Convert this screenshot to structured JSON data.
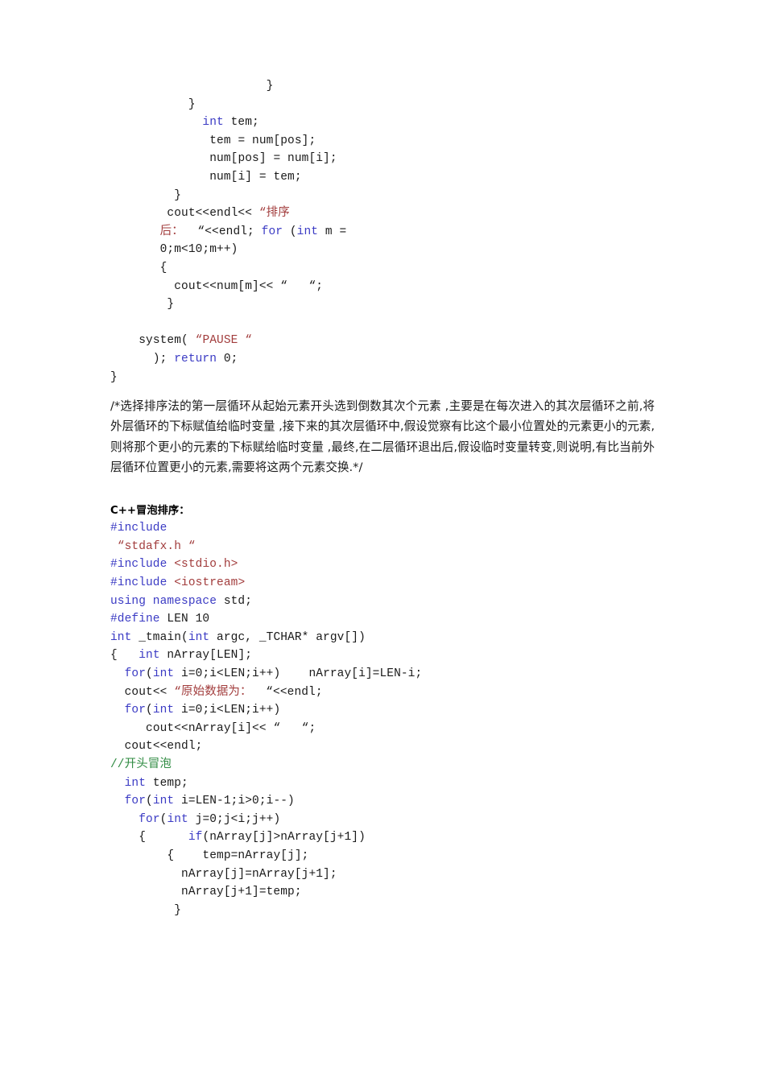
{
  "document": {
    "colors": {
      "keyword": "#3b3bc4",
      "string": "#a23d3d",
      "comment": "#2f8b42",
      "text": "#1a1a1a",
      "background": "#ffffff"
    }
  },
  "selection_sort_tail": {
    "lines": [
      {
        "indent": 22,
        "parts": [
          {
            "t": "}",
            "c": "plain"
          }
        ]
      },
      {
        "indent": 11,
        "parts": [
          {
            "t": "}",
            "c": "plain"
          }
        ]
      },
      {
        "indent": 13,
        "parts": [
          {
            "t": "int",
            "c": "kw"
          },
          {
            "t": " tem;",
            "c": "plain"
          }
        ]
      },
      {
        "indent": 14,
        "parts": [
          {
            "t": "tem = num[pos];",
            "c": "plain"
          }
        ]
      },
      {
        "indent": 14,
        "parts": [
          {
            "t": "num[pos] = num[i];",
            "c": "plain"
          }
        ]
      },
      {
        "indent": 14,
        "parts": [
          {
            "t": "num[i] = tem;",
            "c": "plain"
          }
        ]
      },
      {
        "indent": 9,
        "parts": [
          {
            "t": "}",
            "c": "plain"
          }
        ]
      },
      {
        "indent": 8,
        "parts": [
          {
            "t": "cout<<endl<<",
            "c": "plain"
          },
          {
            "t": " “排序",
            "c": "str"
          }
        ]
      },
      {
        "indent": 7,
        "parts": [
          {
            "t": "后：",
            "c": "str"
          },
          {
            "t": "  “<<endl; ",
            "c": "plain"
          },
          {
            "t": "for",
            "c": "kw"
          },
          {
            "t": " (",
            "c": "plain"
          },
          {
            "t": "int",
            "c": "kw"
          },
          {
            "t": " m =",
            "c": "plain"
          }
        ]
      },
      {
        "indent": 7,
        "parts": [
          {
            "t": "0;m<10;m++)",
            "c": "plain"
          }
        ]
      },
      {
        "indent": 7,
        "parts": [
          {
            "t": "{",
            "c": "plain"
          }
        ]
      },
      {
        "indent": 9,
        "parts": [
          {
            "t": "cout<<num[m]<< “   “;",
            "c": "plain"
          }
        ]
      },
      {
        "indent": 8,
        "parts": [
          {
            "t": "}",
            "c": "plain"
          }
        ]
      },
      {
        "indent": 0,
        "parts": [
          {
            "t": "",
            "c": "plain"
          }
        ]
      },
      {
        "indent": 4,
        "parts": [
          {
            "t": "system( ",
            "c": "plain"
          },
          {
            "t": "“PAUSE “",
            "c": "str"
          }
        ]
      },
      {
        "indent": 6,
        "parts": [
          {
            "t": "); ",
            "c": "plain"
          },
          {
            "t": "return",
            "c": "kw"
          },
          {
            "t": " 0;",
            "c": "plain"
          }
        ]
      },
      {
        "indent": 0,
        "parts": [
          {
            "t": "}",
            "c": "plain"
          }
        ]
      }
    ]
  },
  "explanation": {
    "text": "/*选择排序法的第一层循环从起始元素开头选到倒数其次个元素 ,主要是在每次进入的其次层循环之前,将外层循环的下标赋值给临时变量 ,接下来的其次层循环中,假设觉察有比这个最小位置处的元素更小的元素,则将那个更小的元素的下标赋给临时变量 ,最终,在二层循环退出后,假设临时变量转变,则说明,有比当前外层循环位置更小的元素,需要将这两个元素交换.*/"
  },
  "bubble_sort": {
    "heading": "C++冒泡排序：",
    "lines": [
      {
        "indent": 0,
        "parts": [
          {
            "t": "#include",
            "c": "kw"
          }
        ]
      },
      {
        "indent": 1,
        "parts": [
          {
            "t": "“stdafx.h “",
            "c": "str"
          }
        ]
      },
      {
        "indent": 0,
        "parts": [
          {
            "t": "#include",
            "c": "kw"
          },
          {
            "t": " ",
            "c": "plain"
          },
          {
            "t": "<stdio.h>",
            "c": "str"
          }
        ]
      },
      {
        "indent": 0,
        "parts": [
          {
            "t": "#include",
            "c": "kw"
          },
          {
            "t": " ",
            "c": "plain"
          },
          {
            "t": "<iostream>",
            "c": "str"
          }
        ]
      },
      {
        "indent": 0,
        "parts": [
          {
            "t": "using namespace",
            "c": "kw"
          },
          {
            "t": " std;",
            "c": "plain"
          }
        ]
      },
      {
        "indent": 0,
        "parts": [
          {
            "t": "#define",
            "c": "kw"
          },
          {
            "t": " LEN 10",
            "c": "plain"
          }
        ]
      },
      {
        "indent": 0,
        "parts": [
          {
            "t": "int",
            "c": "kw"
          },
          {
            "t": " _tmain(",
            "c": "plain"
          },
          {
            "t": "int",
            "c": "kw"
          },
          {
            "t": " argc, _TCHAR* argv[])",
            "c": "plain"
          }
        ]
      },
      {
        "indent": 0,
        "parts": [
          {
            "t": "{   ",
            "c": "plain"
          },
          {
            "t": "int",
            "c": "kw"
          },
          {
            "t": " nArray[LEN];",
            "c": "plain"
          }
        ]
      },
      {
        "indent": 2,
        "parts": [
          {
            "t": "for",
            "c": "kw"
          },
          {
            "t": "(",
            "c": "plain"
          },
          {
            "t": "int",
            "c": "kw"
          },
          {
            "t": " i=0;i<LEN;i++)    nArray[i]=LEN-i;",
            "c": "plain"
          }
        ]
      },
      {
        "indent": 2,
        "parts": [
          {
            "t": "cout<< ",
            "c": "plain"
          },
          {
            "t": "“原始数据为：",
            "c": "str"
          },
          {
            "t": "  “<<endl;",
            "c": "plain"
          }
        ]
      },
      {
        "indent": 2,
        "parts": [
          {
            "t": "for",
            "c": "kw"
          },
          {
            "t": "(",
            "c": "plain"
          },
          {
            "t": "int",
            "c": "kw"
          },
          {
            "t": " i=0;i<LEN;i++)",
            "c": "plain"
          }
        ]
      },
      {
        "indent": 5,
        "parts": [
          {
            "t": "cout<<nArray[i]<< “   “;",
            "c": "plain"
          }
        ]
      },
      {
        "indent": 2,
        "parts": [
          {
            "t": "cout<<endl;",
            "c": "plain"
          }
        ]
      },
      {
        "indent": 0,
        "parts": [
          {
            "t": "//开头冒泡",
            "c": "cmt"
          }
        ]
      },
      {
        "indent": 2,
        "parts": [
          {
            "t": "int",
            "c": "kw"
          },
          {
            "t": " temp;",
            "c": "plain"
          }
        ]
      },
      {
        "indent": 2,
        "parts": [
          {
            "t": "for",
            "c": "kw"
          },
          {
            "t": "(",
            "c": "plain"
          },
          {
            "t": "int",
            "c": "kw"
          },
          {
            "t": " i=LEN-1;i>0;i--)",
            "c": "plain"
          }
        ]
      },
      {
        "indent": 4,
        "parts": [
          {
            "t": "for",
            "c": "kw"
          },
          {
            "t": "(",
            "c": "plain"
          },
          {
            "t": "int",
            "c": "kw"
          },
          {
            "t": " j=0;j<i;j++)",
            "c": "plain"
          }
        ]
      },
      {
        "indent": 4,
        "parts": [
          {
            "t": "{      ",
            "c": "plain"
          },
          {
            "t": "if",
            "c": "kw"
          },
          {
            "t": "(nArray[j]>nArray[j+1])",
            "c": "plain"
          }
        ]
      },
      {
        "indent": 8,
        "parts": [
          {
            "t": "{    temp=nArray[j];",
            "c": "plain"
          }
        ]
      },
      {
        "indent": 10,
        "parts": [
          {
            "t": "nArray[j]=nArray[j+1];",
            "c": "plain"
          }
        ]
      },
      {
        "indent": 10,
        "parts": [
          {
            "t": "nArray[j+1]=temp;",
            "c": "plain"
          }
        ]
      },
      {
        "indent": 9,
        "parts": [
          {
            "t": "}",
            "c": "plain"
          }
        ]
      }
    ]
  }
}
